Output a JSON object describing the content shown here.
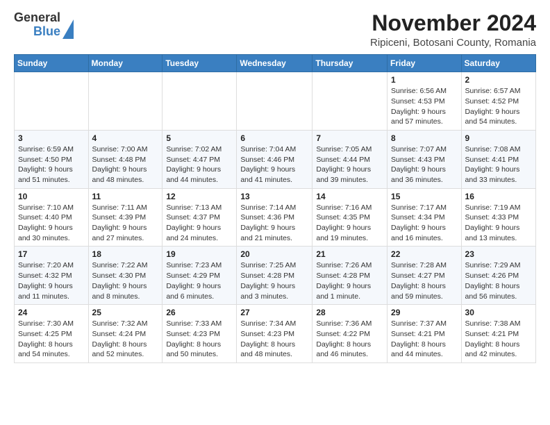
{
  "logo": {
    "general": "General",
    "blue": "Blue"
  },
  "title": "November 2024",
  "location": "Ripiceni, Botosani County, Romania",
  "weekdays": [
    "Sunday",
    "Monday",
    "Tuesday",
    "Wednesday",
    "Thursday",
    "Friday",
    "Saturday"
  ],
  "rows": [
    [
      {
        "day": "",
        "info": ""
      },
      {
        "day": "",
        "info": ""
      },
      {
        "day": "",
        "info": ""
      },
      {
        "day": "",
        "info": ""
      },
      {
        "day": "",
        "info": ""
      },
      {
        "day": "1",
        "info": "Sunrise: 6:56 AM\nSunset: 4:53 PM\nDaylight: 9 hours and 57 minutes."
      },
      {
        "day": "2",
        "info": "Sunrise: 6:57 AM\nSunset: 4:52 PM\nDaylight: 9 hours and 54 minutes."
      }
    ],
    [
      {
        "day": "3",
        "info": "Sunrise: 6:59 AM\nSunset: 4:50 PM\nDaylight: 9 hours and 51 minutes."
      },
      {
        "day": "4",
        "info": "Sunrise: 7:00 AM\nSunset: 4:48 PM\nDaylight: 9 hours and 48 minutes."
      },
      {
        "day": "5",
        "info": "Sunrise: 7:02 AM\nSunset: 4:47 PM\nDaylight: 9 hours and 44 minutes."
      },
      {
        "day": "6",
        "info": "Sunrise: 7:04 AM\nSunset: 4:46 PM\nDaylight: 9 hours and 41 minutes."
      },
      {
        "day": "7",
        "info": "Sunrise: 7:05 AM\nSunset: 4:44 PM\nDaylight: 9 hours and 39 minutes."
      },
      {
        "day": "8",
        "info": "Sunrise: 7:07 AM\nSunset: 4:43 PM\nDaylight: 9 hours and 36 minutes."
      },
      {
        "day": "9",
        "info": "Sunrise: 7:08 AM\nSunset: 4:41 PM\nDaylight: 9 hours and 33 minutes."
      }
    ],
    [
      {
        "day": "10",
        "info": "Sunrise: 7:10 AM\nSunset: 4:40 PM\nDaylight: 9 hours and 30 minutes."
      },
      {
        "day": "11",
        "info": "Sunrise: 7:11 AM\nSunset: 4:39 PM\nDaylight: 9 hours and 27 minutes."
      },
      {
        "day": "12",
        "info": "Sunrise: 7:13 AM\nSunset: 4:37 PM\nDaylight: 9 hours and 24 minutes."
      },
      {
        "day": "13",
        "info": "Sunrise: 7:14 AM\nSunset: 4:36 PM\nDaylight: 9 hours and 21 minutes."
      },
      {
        "day": "14",
        "info": "Sunrise: 7:16 AM\nSunset: 4:35 PM\nDaylight: 9 hours and 19 minutes."
      },
      {
        "day": "15",
        "info": "Sunrise: 7:17 AM\nSunset: 4:34 PM\nDaylight: 9 hours and 16 minutes."
      },
      {
        "day": "16",
        "info": "Sunrise: 7:19 AM\nSunset: 4:33 PM\nDaylight: 9 hours and 13 minutes."
      }
    ],
    [
      {
        "day": "17",
        "info": "Sunrise: 7:20 AM\nSunset: 4:32 PM\nDaylight: 9 hours and 11 minutes."
      },
      {
        "day": "18",
        "info": "Sunrise: 7:22 AM\nSunset: 4:30 PM\nDaylight: 9 hours and 8 minutes."
      },
      {
        "day": "19",
        "info": "Sunrise: 7:23 AM\nSunset: 4:29 PM\nDaylight: 9 hours and 6 minutes."
      },
      {
        "day": "20",
        "info": "Sunrise: 7:25 AM\nSunset: 4:28 PM\nDaylight: 9 hours and 3 minutes."
      },
      {
        "day": "21",
        "info": "Sunrise: 7:26 AM\nSunset: 4:28 PM\nDaylight: 9 hours and 1 minute."
      },
      {
        "day": "22",
        "info": "Sunrise: 7:28 AM\nSunset: 4:27 PM\nDaylight: 8 hours and 59 minutes."
      },
      {
        "day": "23",
        "info": "Sunrise: 7:29 AM\nSunset: 4:26 PM\nDaylight: 8 hours and 56 minutes."
      }
    ],
    [
      {
        "day": "24",
        "info": "Sunrise: 7:30 AM\nSunset: 4:25 PM\nDaylight: 8 hours and 54 minutes."
      },
      {
        "day": "25",
        "info": "Sunrise: 7:32 AM\nSunset: 4:24 PM\nDaylight: 8 hours and 52 minutes."
      },
      {
        "day": "26",
        "info": "Sunrise: 7:33 AM\nSunset: 4:23 PM\nDaylight: 8 hours and 50 minutes."
      },
      {
        "day": "27",
        "info": "Sunrise: 7:34 AM\nSunset: 4:23 PM\nDaylight: 8 hours and 48 minutes."
      },
      {
        "day": "28",
        "info": "Sunrise: 7:36 AM\nSunset: 4:22 PM\nDaylight: 8 hours and 46 minutes."
      },
      {
        "day": "29",
        "info": "Sunrise: 7:37 AM\nSunset: 4:21 PM\nDaylight: 8 hours and 44 minutes."
      },
      {
        "day": "30",
        "info": "Sunrise: 7:38 AM\nSunset: 4:21 PM\nDaylight: 8 hours and 42 minutes."
      }
    ]
  ]
}
